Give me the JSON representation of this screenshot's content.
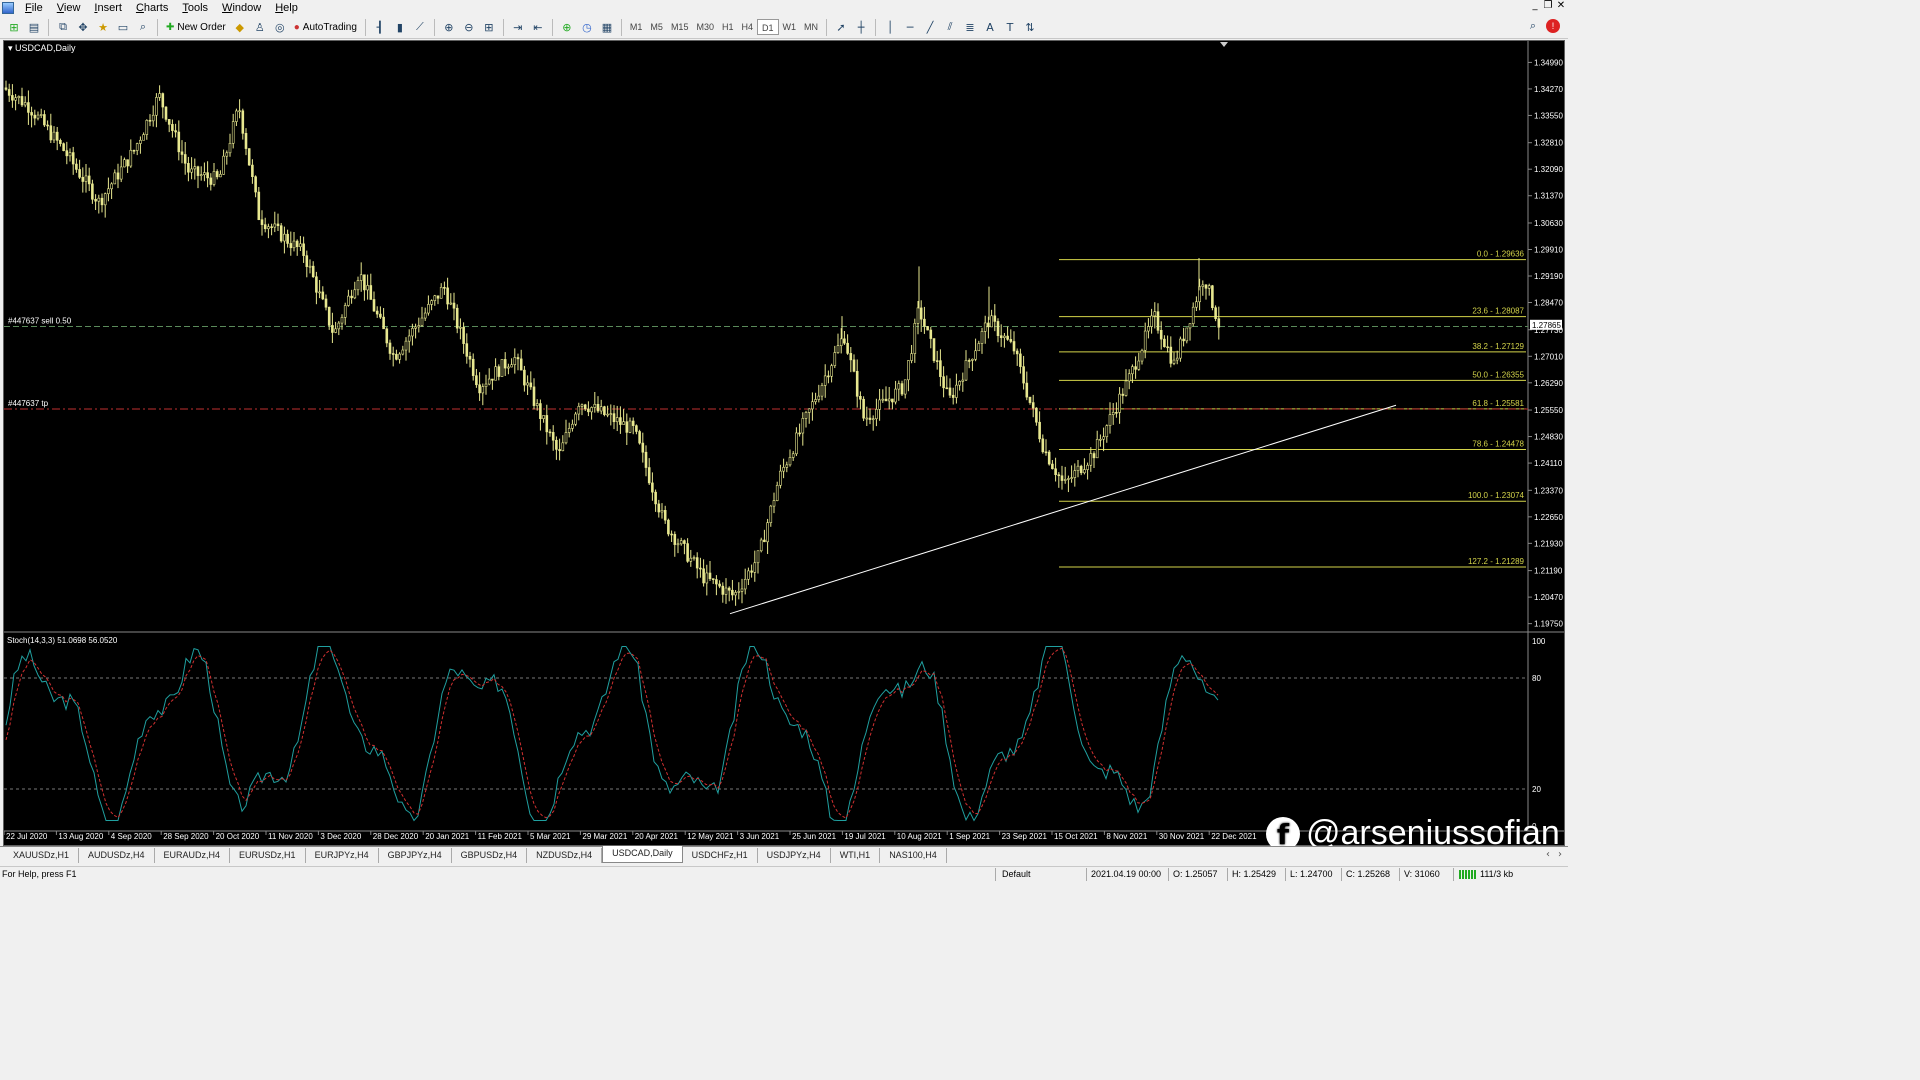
{
  "menu": [
    "File",
    "View",
    "Insert",
    "Charts",
    "Tools",
    "Window",
    "Help"
  ],
  "toolbar": {
    "new_order": "New Order",
    "auto_trading": "AutoTrading",
    "timeframes": [
      "M1",
      "M5",
      "M15",
      "M30",
      "H1",
      "H4",
      "D1",
      "W1",
      "MN"
    ],
    "active_timeframe": "D1"
  },
  "chart": {
    "title": "USDCAD,Daily",
    "current_price": "1.27865",
    "price_axis": [
      "1.34990",
      "1.34270",
      "1.33550",
      "1.32810",
      "1.32090",
      "1.31370",
      "1.30630",
      "1.29910",
      "1.29190",
      "1.28470",
      "1.27730",
      "1.27010",
      "1.26290",
      "1.25550",
      "1.24830",
      "1.24110",
      "1.23370",
      "1.22650",
      "1.21930",
      "1.21190",
      "1.20470",
      "1.19750"
    ],
    "date_axis": [
      "22 Jul 2020",
      "13 Aug 2020",
      "4 Sep 2020",
      "28 Sep 2020",
      "20 Oct 2020",
      "11 Nov 2020",
      "3 Dec 2020",
      "28 Dec 2020",
      "20 Jan 2021",
      "11 Feb 2021",
      "5 Mar 2021",
      "29 Mar 2021",
      "20 Apr 2021",
      "12 May 2021",
      "3 Jun 2021",
      "25 Jun 2021",
      "19 Jul 2021",
      "10 Aug 2021",
      "1 Sep 2021",
      "23 Sep 2021",
      "15 Oct 2021",
      "8 Nov 2021",
      "30 Nov 2021",
      "22 Dec 2021"
    ],
    "order_line": "#447637 sell 0.50",
    "tp_line": "#447637 tp",
    "fibonacci": [
      {
        "label": "0.0 - 1.29636",
        "level": 1.29636
      },
      {
        "label": "23.6 - 1.28087",
        "level": 1.28087
      },
      {
        "label": "38.2 - 1.27129",
        "level": 1.27129
      },
      {
        "label": "50.0 - 1.26355",
        "level": 1.26355
      },
      {
        "label": "61.8 - 1.25581",
        "level": 1.25581
      },
      {
        "label": "78.6 - 1.24478",
        "level": 1.24478
      },
      {
        "label": "100.0 - 1.23074",
        "level": 1.23074
      },
      {
        "label": "127.2 - 1.21289",
        "level": 1.21289
      }
    ],
    "indicator_label": "Stoch(14,3,3) 51.0698 56.0520",
    "indicator_axis": [
      "100",
      "80",
      "20",
      "0"
    ],
    "colors": {
      "candles": "#e8e890",
      "fib": "#d4d44a",
      "order": "#5a8a5a",
      "tp": "#c03030",
      "stoch_main": "#20a0a0",
      "stoch_signal": "#d03030",
      "trendline": "#ffffff"
    }
  },
  "tabs": [
    "XAUUSDz,H1",
    "AUDUSDz,H4",
    "EURAUDz,H4",
    "EURUSDz,H1",
    "EURJPYz,H4",
    "GBPJPYz,H4",
    "GBPUSDz,H4",
    "NZDUSDz,H4",
    "USDCAD,Daily",
    "USDCHFz,H1",
    "USDJPYz,H4",
    "WTI,H1",
    "NAS100,H4"
  ],
  "active_tab": "USDCAD,Daily",
  "status": {
    "help": "For Help, press F1",
    "profile": "Default",
    "datetime": "2021.04.19 00:00",
    "open": "O: 1.25057",
    "high": "H: 1.25429",
    "low": "L: 1.24700",
    "close": "C: 1.25268",
    "volume": "V: 31060",
    "traffic": "111/3 kb"
  },
  "watermark": "@arseniussofian"
}
